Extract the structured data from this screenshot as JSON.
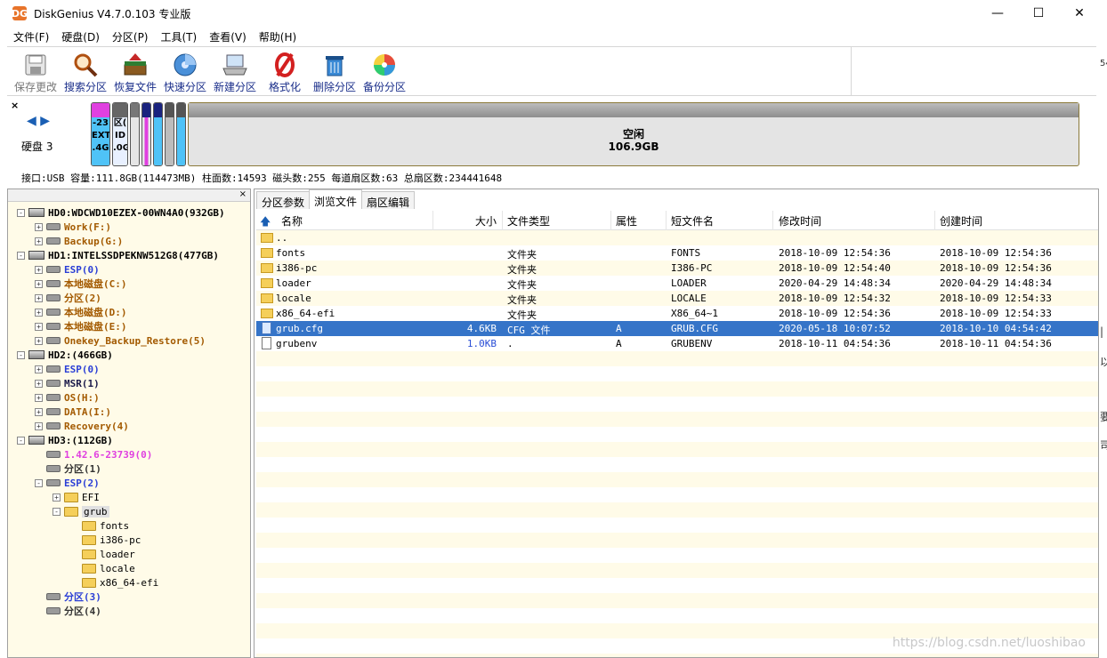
{
  "window": {
    "title": "DiskGenius V4.7.0.103 专业版",
    "app_icon": "DG",
    "minimize": "—",
    "maximize": "☐",
    "close": "✕"
  },
  "menu": [
    "文件(F)",
    "硬盘(D)",
    "分区(P)",
    "工具(T)",
    "查看(V)",
    "帮助(H)"
  ],
  "toolbar": [
    {
      "label": "保存更改",
      "icon": "save-icon",
      "disabled": true
    },
    {
      "label": "搜索分区",
      "icon": "search-icon"
    },
    {
      "label": "恢复文件",
      "icon": "recover-icon"
    },
    {
      "label": "快速分区",
      "icon": "quick-partition-icon"
    },
    {
      "label": "新建分区",
      "icon": "new-partition-icon"
    },
    {
      "label": "格式化",
      "icon": "format-icon"
    },
    {
      "label": "删除分区",
      "icon": "delete-icon"
    },
    {
      "label": "备份分区",
      "icon": "backup-icon"
    }
  ],
  "diskmap": {
    "close": "×",
    "nav_prev": "◀",
    "nav_next": "▶",
    "disk_label": "硬盘 3",
    "small_parts": [
      {
        "line1": "-23",
        "line2": "EXT3",
        "line3": ".4G"
      },
      {
        "line1": "区(",
        "line2": "ID",
        "line3": ".0G"
      }
    ],
    "free_label": "空闲",
    "free_size": "106.9GB",
    "info": "接口:USB  容量:111.8GB(114473MB)  柱面数:14593  磁头数:255  每道扇区数:63  总扇区数:234441648"
  },
  "tree": {
    "header_close": "×",
    "items": [
      {
        "label": "HD0:WDCWD10EZEX-00WN4A0(932GB)",
        "type": "hd",
        "level": 0,
        "exp": "-",
        "color": "c-hd"
      },
      {
        "label": "Work(F:)",
        "type": "part",
        "level": 1,
        "exp": "+",
        "color": "c-brown"
      },
      {
        "label": "Backup(G:)",
        "type": "part",
        "level": 1,
        "exp": "+",
        "color": "c-brown"
      },
      {
        "label": "HD1:INTELSSDPEKNW512G8(477GB)",
        "type": "hd",
        "level": 0,
        "exp": "-",
        "color": "c-hd"
      },
      {
        "label": "ESP(0)",
        "type": "part",
        "level": 1,
        "exp": "+",
        "color": "c-blue"
      },
      {
        "label": "本地磁盘(C:)",
        "type": "part",
        "level": 1,
        "exp": "+",
        "color": "c-brown"
      },
      {
        "label": "分区(2)",
        "type": "part",
        "level": 1,
        "exp": "+",
        "color": "c-brown"
      },
      {
        "label": "本地磁盘(D:)",
        "type": "part",
        "level": 1,
        "exp": "+",
        "color": "c-brown"
      },
      {
        "label": "本地磁盘(E:)",
        "type": "part",
        "level": 1,
        "exp": "+",
        "color": "c-brown"
      },
      {
        "label": "Onekey_Backup_Restore(5)",
        "type": "part",
        "level": 1,
        "exp": "+",
        "color": "c-brown"
      },
      {
        "label": "HD2:(466GB)",
        "type": "hd",
        "level": 0,
        "exp": "-",
        "color": "c-hd"
      },
      {
        "label": "ESP(0)",
        "type": "part",
        "level": 1,
        "exp": "+",
        "color": "c-blue"
      },
      {
        "label": "MSR(1)",
        "type": "part",
        "level": 1,
        "exp": "+",
        "color": "c-dark"
      },
      {
        "label": "OS(H:)",
        "type": "part",
        "level": 1,
        "exp": "+",
        "color": "c-brown"
      },
      {
        "label": "DATA(I:)",
        "type": "part",
        "level": 1,
        "exp": "+",
        "color": "c-brown"
      },
      {
        "label": "Recovery(4)",
        "type": "part",
        "level": 1,
        "exp": "+",
        "color": "c-brown"
      },
      {
        "label": "HD3:(112GB)",
        "type": "hd",
        "level": 0,
        "exp": "-",
        "color": "c-hd"
      },
      {
        "label": "1.42.6-23739(0)",
        "type": "part",
        "level": 1,
        "exp": "",
        "color": "c-pink"
      },
      {
        "label": "分区(1)",
        "type": "part",
        "level": 1,
        "exp": "",
        "color": "c-gray"
      },
      {
        "label": "ESP(2)",
        "type": "part",
        "level": 1,
        "exp": "-",
        "color": "c-blue"
      },
      {
        "label": "EFI",
        "type": "folder",
        "level": 2,
        "exp": "+",
        "color": "c-normal"
      },
      {
        "label": "grub",
        "type": "folder",
        "level": 2,
        "exp": "-",
        "color": "c-normal"
      },
      {
        "label": "fonts",
        "type": "folder",
        "level": 3,
        "exp": "",
        "color": "c-normal"
      },
      {
        "label": "i386-pc",
        "type": "folder",
        "level": 3,
        "exp": "",
        "color": "c-normal"
      },
      {
        "label": "loader",
        "type": "folder",
        "level": 3,
        "exp": "",
        "color": "c-normal"
      },
      {
        "label": "locale",
        "type": "folder",
        "level": 3,
        "exp": "",
        "color": "c-normal"
      },
      {
        "label": "x86_64-efi",
        "type": "folder",
        "level": 3,
        "exp": "",
        "color": "c-normal"
      },
      {
        "label": "分区(3)",
        "type": "part",
        "level": 1,
        "exp": "",
        "color": "c-blue"
      },
      {
        "label": "分区(4)",
        "type": "part",
        "level": 1,
        "exp": "",
        "color": "c-gray"
      }
    ]
  },
  "tabs": [
    {
      "label": "分区参数",
      "active": false
    },
    {
      "label": "浏览文件",
      "active": true
    },
    {
      "label": "扇区编辑",
      "active": false
    }
  ],
  "columns": {
    "up_icon": "🡅",
    "name": "名称",
    "size": "大小",
    "type": "文件类型",
    "attr": "属性",
    "short": "短文件名",
    "modified": "修改时间",
    "created": "创建时间"
  },
  "files": [
    {
      "name": "..",
      "size": "",
      "type": "",
      "attr": "",
      "short": "",
      "modified": "",
      "created": "",
      "kind": "folder",
      "selected": false
    },
    {
      "name": "fonts",
      "size": "",
      "type": "文件夹",
      "attr": "",
      "short": "FONTS",
      "modified": "2018-10-09 12:54:36",
      "created": "2018-10-09 12:54:36",
      "kind": "folder",
      "selected": false
    },
    {
      "name": "i386-pc",
      "size": "",
      "type": "文件夹",
      "attr": "",
      "short": "I386-PC",
      "modified": "2018-10-09 12:54:40",
      "created": "2018-10-09 12:54:36",
      "kind": "folder",
      "selected": false
    },
    {
      "name": "loader",
      "size": "",
      "type": "文件夹",
      "attr": "",
      "short": "LOADER",
      "modified": "2020-04-29 14:48:34",
      "created": "2020-04-29 14:48:34",
      "kind": "folder",
      "selected": false
    },
    {
      "name": "locale",
      "size": "",
      "type": "文件夹",
      "attr": "",
      "short": "LOCALE",
      "modified": "2018-10-09 12:54:32",
      "created": "2018-10-09 12:54:33",
      "kind": "folder",
      "selected": false
    },
    {
      "name": "x86_64-efi",
      "size": "",
      "type": "文件夹",
      "attr": "",
      "short": "X86_64~1",
      "modified": "2018-10-09 12:54:36",
      "created": "2018-10-09 12:54:33",
      "kind": "folder",
      "selected": false
    },
    {
      "name": "grub.cfg",
      "size": "4.6KB",
      "type": "CFG 文件",
      "attr": "A",
      "short": "GRUB.CFG",
      "modified": "2020-05-18 10:07:52",
      "created": "2018-10-10 04:54:42",
      "kind": "cfg",
      "selected": true
    },
    {
      "name": "grubenv",
      "size": "1.0KB",
      "type": ".",
      "attr": "A",
      "short": "GRUBENV",
      "modified": "2018-10-11 04:54:36",
      "created": "2018-10-11 04:54:36",
      "kind": "file",
      "selected": false
    }
  ],
  "watermark": "https://blog.csdn.net/luoshibao",
  "edge_glyphs": [
    "54",
    "|",
    "以",
    "要",
    "司"
  ]
}
